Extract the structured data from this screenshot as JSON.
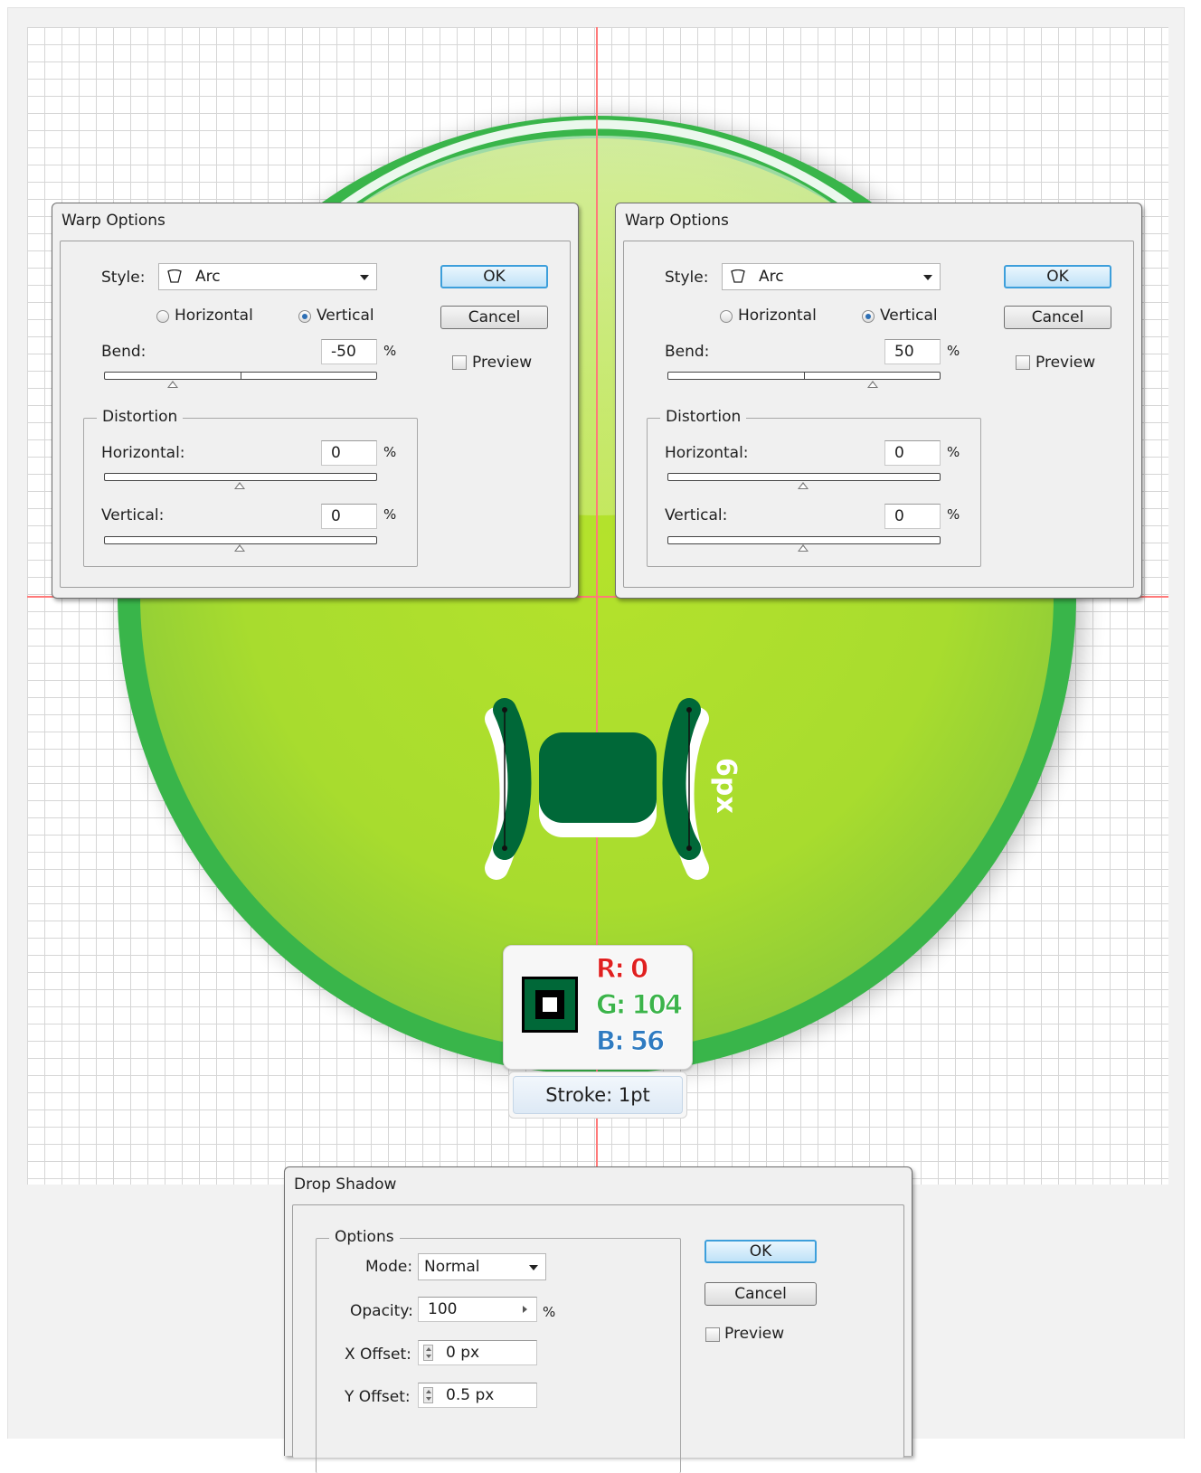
{
  "colors": {
    "ring": "#39b54a",
    "fill_light": "#c8e85a",
    "fill_dark": "#8dc63f",
    "icon": "#006838",
    "guide": "#ff7a7a",
    "r_text": "#e02020",
    "g_text": "#3cb44b",
    "b_text": "#2f7bc1"
  },
  "warp_left": {
    "title": "Warp Options",
    "style_label": "Style:",
    "style_value": "Arc",
    "horizontal_label": "Horizontal",
    "vertical_label": "Vertical",
    "orientation_selected": "Vertical",
    "bend_label": "Bend:",
    "bend_value": "-50",
    "percent": "%",
    "distortion_label": "Distortion",
    "dist_h_label": "Horizontal:",
    "dist_h_value": "0",
    "dist_v_label": "Vertical:",
    "dist_v_value": "0",
    "ok_label": "OK",
    "cancel_label": "Cancel",
    "preview_label": "Preview"
  },
  "warp_right": {
    "title": "Warp Options",
    "style_label": "Style:",
    "style_value": "Arc",
    "horizontal_label": "Horizontal",
    "vertical_label": "Vertical",
    "orientation_selected": "Vertical",
    "bend_label": "Bend:",
    "bend_value": "50",
    "percent": "%",
    "distortion_label": "Distortion",
    "dist_h_label": "Horizontal:",
    "dist_h_value": "0",
    "dist_v_label": "Vertical:",
    "dist_v_value": "0",
    "ok_label": "OK",
    "cancel_label": "Cancel",
    "preview_label": "Preview"
  },
  "dimension_label": "6px",
  "color_info": {
    "r": "R: 0",
    "g": "G: 104",
    "b": "B: 56",
    "stroke": "Stroke: 1pt"
  },
  "drop_shadow": {
    "title": "Drop Shadow",
    "options_label": "Options",
    "mode_label": "Mode:",
    "mode_value": "Normal",
    "opacity_label": "Opacity:",
    "opacity_value": "100",
    "percent": "%",
    "x_offset_label": "X Offset:",
    "x_offset_value": "0 px",
    "y_offset_label": "Y Offset:",
    "y_offset_value": "0.5 px",
    "ok_label": "OK",
    "cancel_label": "Cancel",
    "preview_label": "Preview"
  }
}
